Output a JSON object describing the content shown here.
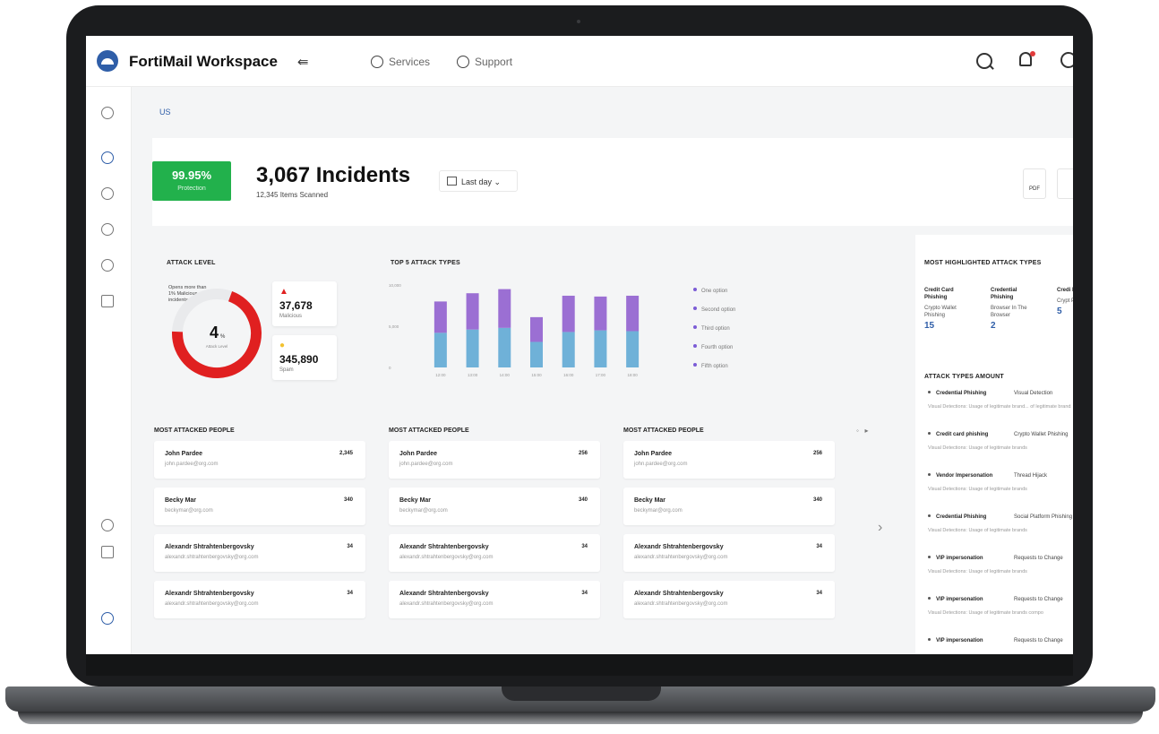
{
  "header": {
    "app_title": "FortiMail Workspace",
    "collapse_icon": "⇚",
    "nav": [
      {
        "label": "Services"
      },
      {
        "label": "Support"
      }
    ]
  },
  "breadcrumb": "US",
  "summary": {
    "protection_pct": "99.95%",
    "protection_label": "Protection",
    "incidents": "3,067 Incidents",
    "scanned": "12,345 Items Scanned",
    "period": "Last day",
    "export_label": "PDF"
  },
  "attack_level": {
    "title": "ATTACK LEVEL",
    "note": "Opens more than 1% Malicious incidents",
    "value": "4",
    "unit": "%",
    "caption": "Attack Level",
    "level_fraction": 0.7,
    "malicious": {
      "value": "37,678",
      "label": "Malicious",
      "icon": "▲"
    },
    "spam": {
      "value": "345,890",
      "label": "Spam",
      "icon": "●"
    }
  },
  "chart_data": {
    "type": "bar",
    "title": "TOP 5 ATTACK TYPES",
    "categories": [
      "12:00",
      "13:00",
      "14:00",
      "15:00",
      "16:00",
      "17:00",
      "18:00"
    ],
    "series": [
      {
        "values": [
          4200,
          4600,
          4800,
          3100,
          4300,
          4500,
          4400
        ]
      },
      {
        "values": [
          3800,
          4400,
          4700,
          3000,
          4400,
          4100,
          4300
        ]
      }
    ],
    "ylim": [
      0,
      10000
    ],
    "yticks": [
      "10,000",
      "5,000",
      "0"
    ],
    "colors": [
      "#6fb1d8",
      "#9b6fd3"
    ],
    "legend": [
      "One option",
      "Second option",
      "Third option",
      "Fourth option",
      "Fifth option"
    ],
    "legend_placement": "right"
  },
  "highlighted": {
    "title": "MOST HIGHLIGHTED ATTACK TYPES",
    "cols": [
      {
        "title": "Credit Card Phishing",
        "sub": "Crypto Wallet Phishing",
        "value": "15"
      },
      {
        "title": "Credential Phishing",
        "sub": "Browser In The Browser",
        "value": "2"
      },
      {
        "title": "Credi Phishi",
        "sub": "Crypt Phish",
        "value": "5"
      }
    ]
  },
  "amounts": {
    "title": "ATTACK TYPES AMOUNT",
    "items": [
      {
        "name": "Credential Phishing",
        "secondary": "Visual Detection",
        "desc": "Visual Detections: Usage of legitimate brand... of legitimate brands components in phishing"
      },
      {
        "name": "Credit card phishing",
        "secondary": "Crypto Wallet Phishing",
        "desc": "Visual Detections: Usage of legitimate brands"
      },
      {
        "name": "Vendor Impersonation",
        "secondary": "Thread Hijack",
        "desc": "Visual Detections: Usage of legitimate brands"
      },
      {
        "name": "Credential Phishing",
        "secondary": "Social Platform Phishing",
        "desc": "Visual Detections: Usage of legitimate brands"
      },
      {
        "name": "VIP impersonation",
        "secondary": "Requests to Change",
        "desc": "Visual Detections: Usage of legitimate brands"
      },
      {
        "name": "VIP impersonation",
        "secondary": "Requests to Change",
        "desc": "Visual Detections: Usage of legitimate brands compo"
      },
      {
        "name": "VIP impersonation",
        "secondary": "Requests to Change",
        "desc": ""
      }
    ]
  },
  "people": [
    {
      "title": "MOST ATTACKED PEOPLE",
      "rows": [
        {
          "name": "John Pardee",
          "email": "john.pardee@org.com",
          "count": "2,345"
        },
        {
          "name": "Becky Mar",
          "email": "beckymar@org.com",
          "count": "340"
        },
        {
          "name": "Alexandr Shtrahtenbergovsky",
          "email": "alexandr.shtrahtenbergovsky@org.com",
          "count": "34"
        },
        {
          "name": "Alexandr Shtrahtenbergovsky",
          "email": "alexandr.shtrahtenbergovsky@org.com",
          "count": "34"
        }
      ]
    },
    {
      "title": "MOST ATTACKED PEOPLE",
      "rows": [
        {
          "name": "John Pardee",
          "email": "john.pardee@org.com",
          "count": "256"
        },
        {
          "name": "Becky Mar",
          "email": "beckymar@org.com",
          "count": "340"
        },
        {
          "name": "Alexandr Shtrahtenbergovsky",
          "email": "alexandr.shtrahtenbergovsky@org.com",
          "count": "34"
        },
        {
          "name": "Alexandr Shtrahtenbergovsky",
          "email": "alexandr.shtrahtenbergovsky@org.com",
          "count": "34"
        }
      ]
    },
    {
      "title": "MOST ATTACKED PEOPLE",
      "rows": [
        {
          "name": "John Pardee",
          "email": "john.pardee@org.com",
          "count": "256"
        },
        {
          "name": "Becky Mar",
          "email": "beckymar@org.com",
          "count": "340"
        },
        {
          "name": "Alexandr Shtrahtenbergovsky",
          "email": "alexandr.shtrahtenbergovsky@org.com",
          "count": "34"
        },
        {
          "name": "Alexandr Shtrahtenbergovsky",
          "email": "alexandr.shtrahtenbergovsky@org.com",
          "count": "34"
        }
      ]
    }
  ],
  "pager": {
    "prev": "◦",
    "next": "▸",
    "arrow": "›"
  },
  "colors": {
    "accent": "#2f5ea8",
    "protection": "#22b14c",
    "danger": "#e02020",
    "bar_top": "#9b6fd3",
    "bar_bottom": "#6fb1d8"
  }
}
